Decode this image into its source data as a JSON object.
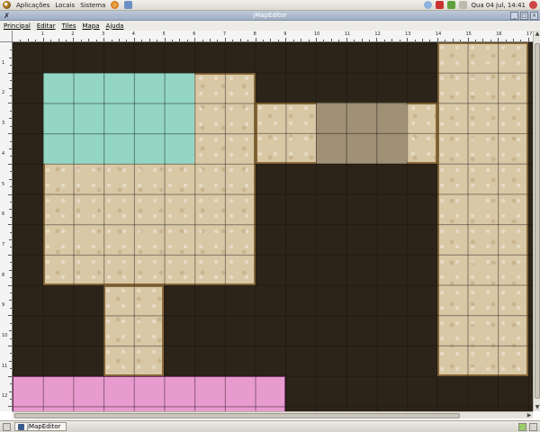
{
  "top_panel": {
    "menus": [
      "Aplicações",
      "Locais",
      "Sistema"
    ],
    "clock": "Qua 04 jul, 14:41"
  },
  "window": {
    "title": "jMapEditor"
  },
  "menubar": {
    "items": [
      "Principal",
      "Editar",
      "Tiles",
      "Mapa",
      "Ajuda"
    ]
  },
  "ruler": {
    "columns": [
      "1",
      "2",
      "3",
      "4",
      "5",
      "6",
      "7",
      "8",
      "9",
      "10",
      "11",
      "12",
      "13",
      "14",
      "15",
      "16",
      "17"
    ],
    "rows": [
      "1",
      "2",
      "3",
      "4",
      "5",
      "6",
      "7",
      "8",
      "9",
      "10",
      "11",
      "12"
    ]
  },
  "map": {
    "cell_units": 1,
    "rooms": [
      {
        "kind": "floor",
        "col": 1,
        "row": 1,
        "w": 7,
        "h": 7
      },
      {
        "kind": "water",
        "col": 1,
        "row": 1,
        "w": 5,
        "h": 3
      },
      {
        "kind": "floor",
        "col": 8,
        "row": 2,
        "w": 6,
        "h": 2
      },
      {
        "kind": "dark",
        "col": 10,
        "row": 2,
        "w": 3,
        "h": 2
      },
      {
        "kind": "floor",
        "col": 14,
        "row": 0,
        "w": 3,
        "h": 11
      },
      {
        "kind": "floor",
        "col": 3,
        "row": 8,
        "w": 2,
        "h": 3
      },
      {
        "kind": "pink",
        "col": 0,
        "row": 11,
        "w": 9,
        "h": 1.2
      }
    ],
    "colors": {
      "background": "#2c2419",
      "floor": "#d9c8a6",
      "water": "#93d6c3",
      "dark": "#9f9076",
      "pink": "#e89bce"
    }
  },
  "taskbar": {
    "window_button": "jMapEditor"
  }
}
